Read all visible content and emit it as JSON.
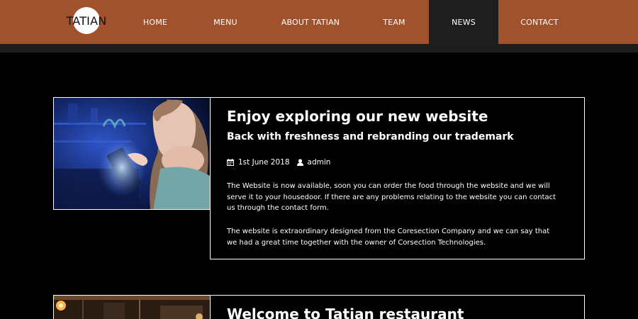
{
  "header": {
    "logo_text": "TATIAN",
    "nav": [
      {
        "label": "HOME",
        "active": false
      },
      {
        "label": "MENU",
        "active": false
      },
      {
        "label": "ABOUT TATIAN",
        "active": false
      },
      {
        "label": "TEAM",
        "active": false
      },
      {
        "label": "NEWS",
        "active": true
      },
      {
        "label": "CONTACT",
        "active": false
      }
    ]
  },
  "posts": [
    {
      "title": "Enjoy exploring our new website",
      "subtitle": "Back with freshness and rebranding our trademark",
      "date": "1st June 2018",
      "author": "admin",
      "paragraphs": [
        "The Website is now available, soon you can order the food through the website and we will serve it to your housedoor. If there are any problems relating to the website you can contact us through the contact form.",
        "The website is extraordinary designed from the Coresection Company and we can say that we had a great time together with the owner of Corsection Technologies."
      ]
    },
    {
      "title": "Welcome to Tatian restaurant"
    }
  ],
  "colors": {
    "header_bg": "#a0522d",
    "active_nav_bg": "#1e1e1e",
    "page_bg": "#000000",
    "border": "#ffffff"
  },
  "icons": {
    "date": "calendar-icon",
    "author": "user-icon"
  }
}
